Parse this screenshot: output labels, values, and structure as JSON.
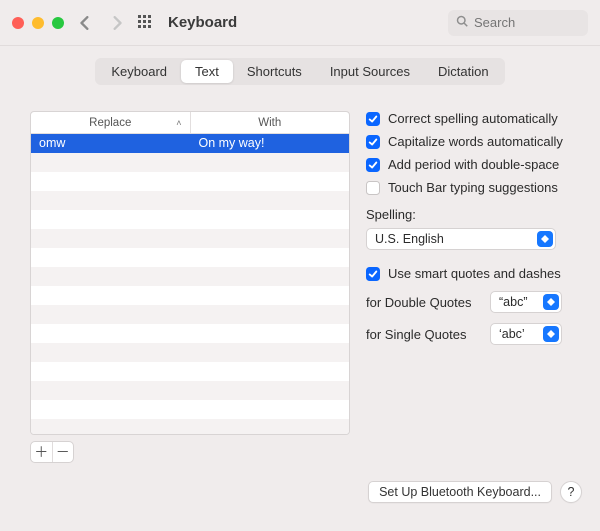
{
  "window": {
    "title": "Keyboard"
  },
  "search": {
    "placeholder": "Search",
    "value": ""
  },
  "tabs": [
    {
      "label": "Keyboard",
      "active": false
    },
    {
      "label": "Text",
      "active": true
    },
    {
      "label": "Shortcuts",
      "active": false
    },
    {
      "label": "Input Sources",
      "active": false
    },
    {
      "label": "Dictation",
      "active": false
    }
  ],
  "text_table": {
    "columns": {
      "replace": "Replace",
      "with": "With"
    },
    "rows": [
      {
        "replace": "omw",
        "with": "On my way!",
        "selected": true
      }
    ]
  },
  "options": {
    "correct_spelling": {
      "label": "Correct spelling automatically",
      "checked": true
    },
    "capitalize_words": {
      "label": "Capitalize words automatically",
      "checked": true
    },
    "double_space_period": {
      "label": "Add period with double-space",
      "checked": true
    },
    "touch_bar_suggest": {
      "label": "Touch Bar typing suggestions",
      "checked": false
    },
    "smart_quotes": {
      "label": "Use smart quotes and dashes",
      "checked": true
    }
  },
  "spelling": {
    "label": "Spelling:",
    "value": "U.S. English"
  },
  "double_quotes": {
    "label": "for Double Quotes",
    "value": "“abc”"
  },
  "single_quotes": {
    "label": "for Single Quotes",
    "value": "‘abc’"
  },
  "footer": {
    "bluetooth": "Set Up Bluetooth Keyboard...",
    "help": "?"
  }
}
